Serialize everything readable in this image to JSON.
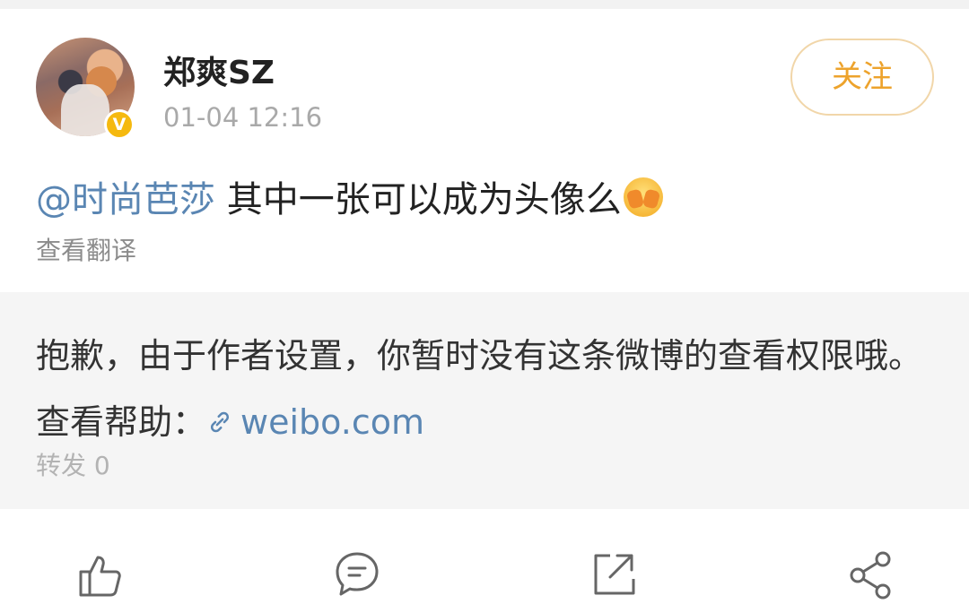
{
  "post": {
    "username": "郑爽SZ",
    "timestamp": "01-04 12:16",
    "verified_badge": "V",
    "follow_label": "关注",
    "mention": "@时尚芭莎",
    "text": " 其中一张可以成为头像么",
    "emoji": "shy-face-emoji",
    "translate_label": "查看翻译"
  },
  "repost": {
    "notice": "抱歉，由于作者设置，你暂时没有这条微博的查看权限哦。查看帮助：",
    "link_text": "weibo.com",
    "repost_count": "转发 0"
  },
  "actions": {
    "icons": [
      "like-icon",
      "comment-icon",
      "repost-icon",
      "share-icon"
    ]
  },
  "colors": {
    "accent_follow": "#eda32c",
    "link_blue": "#5a86b3",
    "verified_gold": "#f5b90f"
  }
}
